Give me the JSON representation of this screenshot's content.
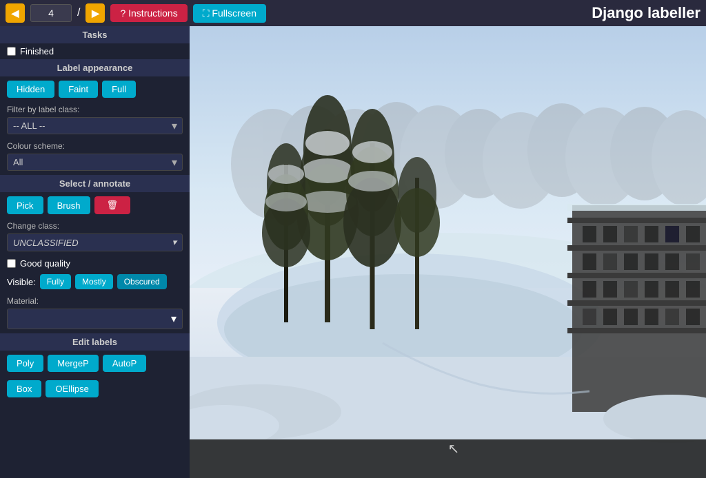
{
  "topbar": {
    "frame_value": "4",
    "frame_placeholder": "4",
    "prev_btn_label": "◀",
    "next_btn_label": "▶",
    "slash": "/",
    "instructions_label": "? Instructions",
    "fullscreen_label": "⛶ Fullscreen",
    "app_title": "Django labeller"
  },
  "sidebar": {
    "tasks_header": "Tasks",
    "finished_label": "Finished",
    "label_appearance_header": "Label appearance",
    "hidden_btn": "Hidden",
    "faint_btn": "Faint",
    "full_btn": "Full",
    "filter_label": "Filter by label class:",
    "filter_value": "-- ALL --",
    "colour_scheme_label": "Colour scheme:",
    "colour_scheme_value": "All",
    "select_annotate_header": "Select / annotate",
    "pick_btn": "Pick",
    "brush_btn": "Brush",
    "delete_icon": "🗑",
    "change_class_label": "Change class:",
    "unclassified_value": "UNCLASSIFIED",
    "good_quality_label": "Good quality",
    "visible_label": "Visible:",
    "fully_btn": "Fully",
    "mostly_btn": "Mostly",
    "obscured_btn": "Obscured",
    "material_label": "Material:",
    "edit_labels_header": "Edit labels",
    "poly_btn": "Poly",
    "mergep_btn": "MergeP",
    "autop_btn": "AutoP",
    "box_btn": "Box",
    "oellipse_btn": "OEllipse"
  },
  "colours": {
    "cyan": "#00aacc",
    "red": "#cc2244",
    "orange": "#f0a500",
    "sidebar_bg": "#1e2233",
    "section_header_bg": "#2a3050",
    "canvas_bottom_bg": "#1a1a1a"
  }
}
